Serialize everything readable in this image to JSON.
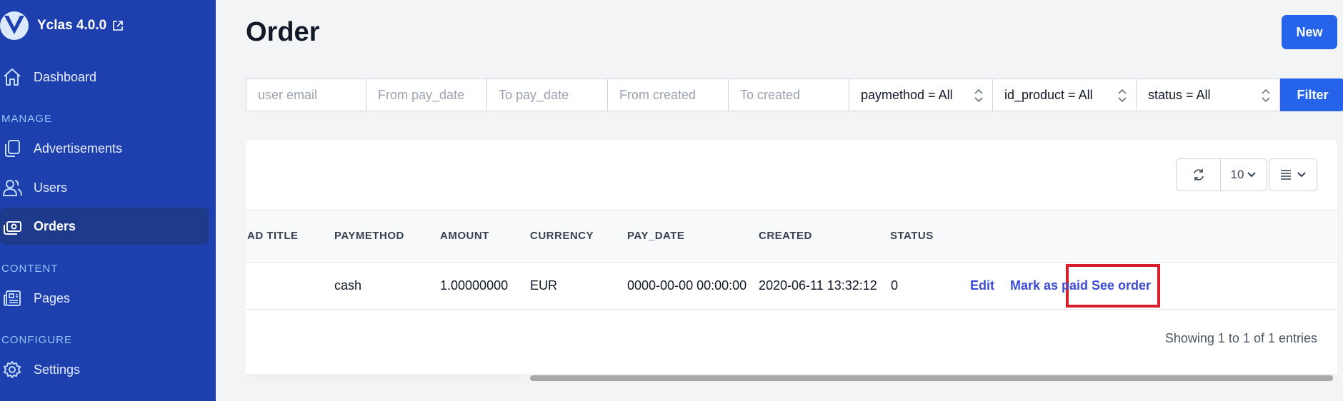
{
  "brand": {
    "name": "Yclas 4.0.0"
  },
  "sidebar": {
    "dashboard": "Dashboard",
    "sections": {
      "manage": "MANAGE",
      "content": "CONTENT",
      "configure": "CONFIGURE"
    },
    "items": {
      "advertisements": "Advertisements",
      "users": "Users",
      "orders": "Orders",
      "pages": "Pages",
      "settings": "Settings"
    }
  },
  "page": {
    "title": "Order",
    "new_label": "New"
  },
  "filters": {
    "user_email": {
      "placeholder": "user email"
    },
    "from_pay_date": {
      "placeholder": "From pay_date"
    },
    "to_pay_date": {
      "placeholder": "To pay_date"
    },
    "from_created": {
      "placeholder": "From created"
    },
    "to_created": {
      "placeholder": "To created"
    },
    "paymethod": "paymethod = All",
    "id_product": "id_product = All",
    "status": "status = All",
    "filter_label": "Filter"
  },
  "toolbar": {
    "page_size": "10"
  },
  "table": {
    "headers": [
      "AD TITLE",
      "PAYMETHOD",
      "AMOUNT",
      "CURRENCY",
      "PAY_DATE",
      "CREATED",
      "STATUS"
    ],
    "rows": [
      {
        "paymethod": "cash",
        "amount": "1.00000000",
        "currency": "EUR",
        "pay_date": "0000-00-00 00:00:00",
        "created": "2020-06-11 13:32:12",
        "status": "0",
        "actions": {
          "edit": "Edit",
          "mark_paid": "Mark as paid",
          "see_order": "See order"
        }
      }
    ],
    "info": "Showing 1 to 1 of 1 entries"
  },
  "colors": {
    "sidebar": "#1e40af",
    "sidebar_active": "#1e3a8a",
    "primary": "#2563eb",
    "link": "#3b4bd3",
    "highlight": "#d61f2b"
  }
}
